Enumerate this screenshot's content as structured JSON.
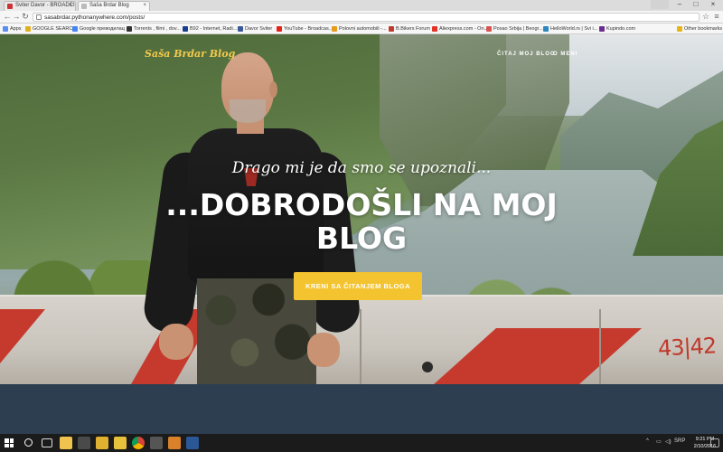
{
  "browser": {
    "tabs": [
      {
        "title": "Sviter Davor - BROADCI",
        "active": false
      },
      {
        "title": "Saša Brdar Blog",
        "active": true
      }
    ],
    "url": "sasabrdar.pythonanywhere.com/posts/",
    "bookmarks": [
      {
        "label": "Apps",
        "color": "#5b8def"
      },
      {
        "label": "GOOGLE SEARCH",
        "color": "#e0b020"
      },
      {
        "label": "Google преводилац",
        "color": "#4285f4"
      },
      {
        "label": "Torrents , filmi , dov...",
        "color": "#333333"
      },
      {
        "label": "B92 - Internet, Radi...",
        "color": "#1a3d8f"
      },
      {
        "label": "Davor Sviter",
        "color": "#3b5998"
      },
      {
        "label": "YouTube - Broadcas...",
        "color": "#e62117"
      },
      {
        "label": "Polovni automobili -...",
        "color": "#e89b1c"
      },
      {
        "label": "B.Bikers Forum",
        "color": "#c0392b"
      },
      {
        "label": "Aliexpress.com - On...",
        "color": "#e43225"
      },
      {
        "label": "Posao Srbija | Beogr...",
        "color": "#d9534f"
      },
      {
        "label": "HelloWorld.rs | Svi i...",
        "color": "#2e86c1"
      },
      {
        "label": "Kupindo.com",
        "color": "#6a2c91"
      },
      {
        "label": "Other bookmarks",
        "color": "#e7b416"
      }
    ]
  },
  "site": {
    "brand": "Saša Brdar Blog",
    "nav": [
      "ČITAJ MOJ BLOG",
      "O MENI"
    ],
    "subheading": "Drago mi je da smo se upoznali...",
    "heading": "...DOBRODOŠLI NA MOJ BLOG",
    "cta": "KRENI SA ČITANJEM BLOGA",
    "wall_number": "43|42"
  },
  "taskbar": {
    "time": "9:21 PM",
    "date": "2/10/2016",
    "lang": "SRP"
  },
  "colors": {
    "accent": "#f4c430",
    "brand": "#f2c94c",
    "dark_section": "#2c3e50"
  }
}
